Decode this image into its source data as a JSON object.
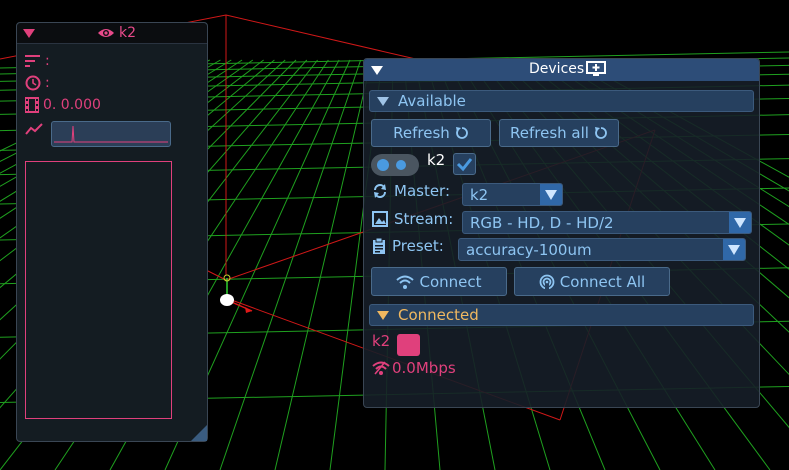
{
  "scene": {
    "grid_color": "#1fa01f",
    "axis_color": "#d01818"
  },
  "stream_panel": {
    "title": "k2",
    "eye_icon": "eye-icon",
    "rows": {
      "bitrate": ":",
      "time": ":",
      "frames": "0.  0.000"
    },
    "accent": "#e0407c"
  },
  "devices": {
    "title": "Devices",
    "title_icon": "monitor-plus-icon",
    "available": {
      "header": "Available",
      "refresh_label": "Refresh",
      "refresh_all_label": "Refresh all",
      "device_name": "k2",
      "device_enabled": true,
      "master_label": "Master:",
      "master_value": "k2",
      "stream_label": "Stream:",
      "stream_value": "RGB - HD, D - HD/2",
      "preset_label": "Preset:",
      "preset_value": "accuracy-100um",
      "connect_label": "Connect",
      "connect_all_label": "Connect All"
    },
    "connected": {
      "header": "Connected",
      "device_name": "k2",
      "device_color": "#e0407c",
      "rate": "0.0Mbps"
    },
    "colors": {
      "title_bar": "#2d4d78",
      "button": "#26405f",
      "text_blue": "#8ec5f2",
      "connected_header": "#f0b860"
    }
  }
}
